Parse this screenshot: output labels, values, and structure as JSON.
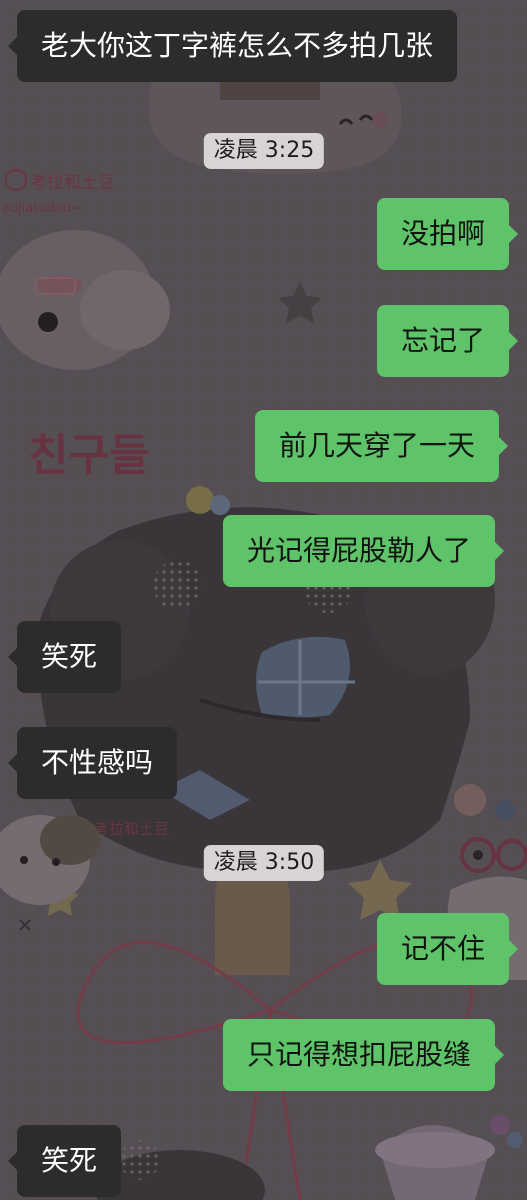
{
  "theme": {
    "incoming_bubble_color": "#2c2c2c",
    "outgoing_bubble_color": "#5fc36a",
    "timestamp_pill_color": "#d8d3d6"
  },
  "wallpaper": {
    "sticker_text_1": "考拉和土豆",
    "sticker_text_2": "aojiatudou~",
    "sticker_text_3": "친구들",
    "sticker_text_4": "考拉和土豆"
  },
  "messages": [
    {
      "direction": "incoming",
      "text": "老大你这丁字裤怎么不多拍几张"
    },
    {
      "direction": "timestamp",
      "text": "凌晨 3:25"
    },
    {
      "direction": "outgoing",
      "text": "没拍啊"
    },
    {
      "direction": "outgoing",
      "text": "忘记了"
    },
    {
      "direction": "outgoing",
      "text": "前几天穿了一天"
    },
    {
      "direction": "outgoing",
      "text": "光记得屁股勒人了"
    },
    {
      "direction": "incoming",
      "text": "笑死"
    },
    {
      "direction": "incoming",
      "text": "不性感吗"
    },
    {
      "direction": "timestamp",
      "text": "凌晨 3:50"
    },
    {
      "direction": "outgoing",
      "text": "记不住"
    },
    {
      "direction": "outgoing",
      "text": "只记得想扣屁股缝"
    },
    {
      "direction": "incoming",
      "text": "笑死"
    }
  ]
}
